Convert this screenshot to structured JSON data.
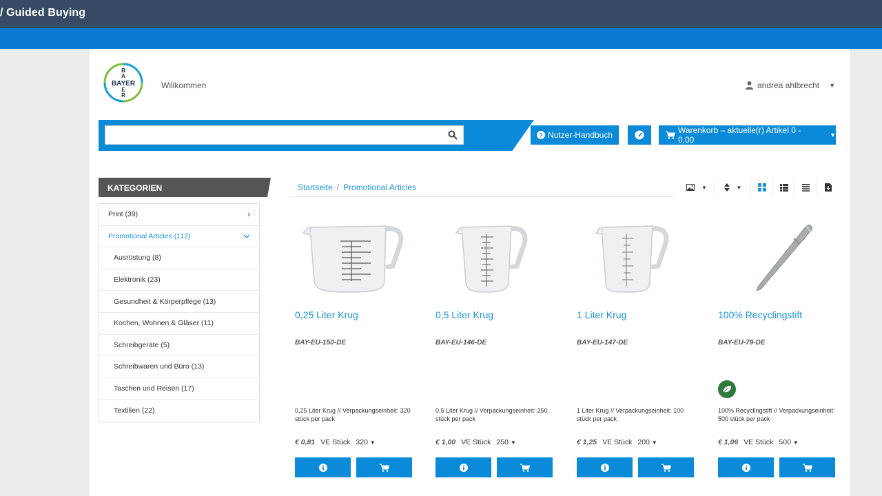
{
  "topbar": {
    "title": "/  Guided Buying"
  },
  "header": {
    "welcome": "Willkommen",
    "user_name": "andrea ahlbrecht",
    "logo_text": "BAYER"
  },
  "search": {
    "placeholder": "",
    "value": ""
  },
  "buttons": {
    "help": "Nutzer-Handbuch",
    "cart": "Warenkorb – aktuelle(r) Artikel 0 - 0,00"
  },
  "sidebar": {
    "heading": "KATEGORIEN",
    "items": [
      {
        "label": "Print (39)"
      },
      {
        "label": "Promotional Articles (112)"
      },
      {
        "label": "Ausrüstung (8)"
      },
      {
        "label": "Elektronik (23)"
      },
      {
        "label": "Gesundheit & Körperpflege (13)"
      },
      {
        "label": "Kochen, Wohnen & Gläser (11)"
      },
      {
        "label": "Schreibgeräte (5)"
      },
      {
        "label": "Schreibwaren und Büro (13)"
      },
      {
        "label": "Taschen und Reisen (17)"
      },
      {
        "label": "Textilien (22)"
      }
    ]
  },
  "breadcrumb": {
    "home": "Startseite",
    "sep": "/",
    "current": "Promotional Articles"
  },
  "colors": {
    "accent": "#0a8ad8",
    "link": "#1b93d8",
    "topbar": "#354a63",
    "eco": "#2f7a3d"
  },
  "products": [
    {
      "name": "0,25 Liter Krug",
      "sku": "BAY-EU-150-DE",
      "desc": "0,25 Liter Krug // Verpackungseinheit: 320 stück per pack",
      "price": "€ 0,81",
      "unit": "VE Stück",
      "qty": "320",
      "icon": "measuring-jug-icon"
    },
    {
      "name": "0,5 Liter Krug",
      "sku": "BAY-EU-146-DE",
      "desc": "0,5 Liter Krug // Verpackungseinheit: 250 stück per pack",
      "price": "€ 1,00",
      "unit": "VE Stück",
      "qty": "250",
      "icon": "measuring-jug-icon"
    },
    {
      "name": "1 Liter Krug",
      "sku": "BAY-EU-147-DE",
      "desc": "1 Liter Krug // Verpackungseinheit: 100 stück per pack",
      "price": "€ 1,25",
      "unit": "VE Stück",
      "qty": "200",
      "icon": "measuring-jug-icon"
    },
    {
      "name": "100% Recyclingstift",
      "sku": "BAY-EU-79-DE",
      "desc": "100% Recyclingstift // Verpackungseinheit: 500 stück per pack",
      "price": "€ 1,06",
      "unit": "VE Stück",
      "qty": "500",
      "icon": "pen-icon"
    }
  ]
}
